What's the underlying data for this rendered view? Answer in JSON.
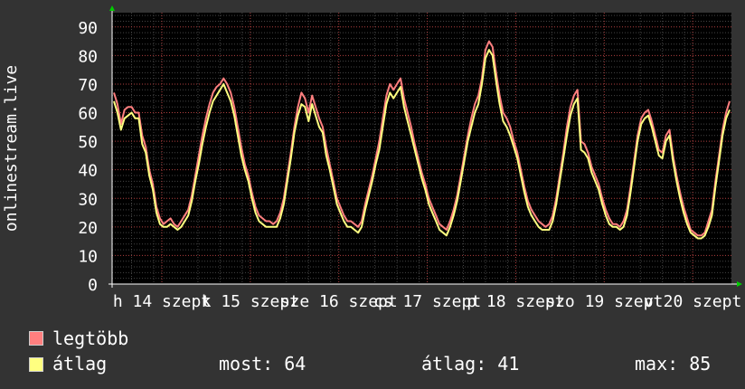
{
  "chart_data": {
    "type": "line",
    "ylabel": "onlinestream.live",
    "ylim": [
      0,
      95
    ],
    "yticks": [
      0,
      10,
      20,
      30,
      40,
      50,
      60,
      70,
      80,
      90
    ],
    "xlabels": [
      "h 14 szept",
      "k 15 szept",
      "sze 16 szept",
      "cs 17 szept",
      "p 18 szept",
      "szo 19 szept",
      "v 20 szept"
    ],
    "grid": true,
    "series": [
      {
        "name": "legtöbb",
        "color": "#ff7f7f",
        "values": [
          67,
          63,
          56,
          61,
          62,
          62,
          60,
          60,
          52,
          48,
          40,
          35,
          27,
          23,
          21,
          22,
          23,
          21,
          20,
          22,
          24,
          26,
          31,
          38,
          45,
          52,
          58,
          63,
          67,
          69,
          70,
          72,
          70,
          67,
          62,
          55,
          48,
          42,
          38,
          32,
          27,
          24,
          23,
          22,
          22,
          21,
          22,
          25,
          30,
          38,
          46,
          55,
          62,
          67,
          65,
          60,
          66,
          62,
          58,
          55,
          48,
          42,
          36,
          30,
          27,
          24,
          22,
          22,
          21,
          20,
          22,
          28,
          33,
          38,
          44,
          50,
          58,
          66,
          70,
          68,
          70,
          72,
          65,
          60,
          55,
          49,
          44,
          39,
          35,
          30,
          27,
          24,
          21,
          20,
          19,
          22,
          26,
          31,
          38,
          45,
          52,
          58,
          63,
          66,
          72,
          82,
          85,
          83,
          74,
          66,
          60,
          58,
          55,
          50,
          46,
          40,
          34,
          29,
          26,
          24,
          22,
          21,
          20,
          21,
          24,
          30,
          38,
          46,
          55,
          62,
          66,
          68,
          50,
          49,
          46,
          41,
          38,
          35,
          30,
          26,
          23,
          21,
          21,
          20,
          22,
          26,
          34,
          43,
          52,
          58,
          60,
          61,
          57,
          52,
          47,
          46,
          52,
          54,
          45,
          38,
          32,
          27,
          23,
          19,
          18,
          17,
          17,
          18,
          22,
          26,
          36,
          45,
          54,
          60,
          64
        ]
      },
      {
        "name": "átlag",
        "color": "#ffff80",
        "values": [
          64,
          60,
          54,
          58,
          59,
          60,
          58,
          58,
          49,
          46,
          38,
          33,
          25,
          21,
          20,
          20,
          21,
          20,
          19,
          20,
          22,
          24,
          29,
          36,
          42,
          49,
          55,
          60,
          64,
          66,
          68,
          70,
          67,
          64,
          59,
          52,
          45,
          40,
          36,
          30,
          25,
          22,
          21,
          20,
          20,
          20,
          20,
          23,
          28,
          36,
          44,
          53,
          59,
          63,
          62,
          57,
          63,
          59,
          55,
          53,
          45,
          40,
          34,
          28,
          25,
          22,
          20,
          20,
          19,
          18,
          20,
          26,
          31,
          36,
          42,
          47,
          55,
          63,
          67,
          65,
          67,
          69,
          62,
          57,
          52,
          47,
          42,
          37,
          33,
          28,
          25,
          22,
          19,
          18,
          17,
          20,
          24,
          29,
          36,
          43,
          50,
          55,
          60,
          63,
          70,
          79,
          82,
          80,
          71,
          63,
          57,
          55,
          52,
          48,
          44,
          38,
          32,
          27,
          24,
          22,
          20,
          19,
          19,
          19,
          22,
          28,
          36,
          44,
          52,
          59,
          63,
          65,
          47,
          46,
          44,
          39,
          36,
          33,
          28,
          24,
          21,
          20,
          20,
          19,
          20,
          24,
          32,
          41,
          50,
          56,
          58,
          59,
          55,
          50,
          45,
          44,
          50,
          52,
          43,
          36,
          30,
          25,
          21,
          18,
          17,
          16,
          16,
          17,
          20,
          24,
          34,
          43,
          52,
          58,
          61
        ]
      }
    ]
  },
  "legend": {
    "max_label": "legtöbb",
    "avg_label": "átlag"
  },
  "stats": {
    "current": "most: 64",
    "average": "átlag: 41",
    "maximum": "max: 85"
  }
}
